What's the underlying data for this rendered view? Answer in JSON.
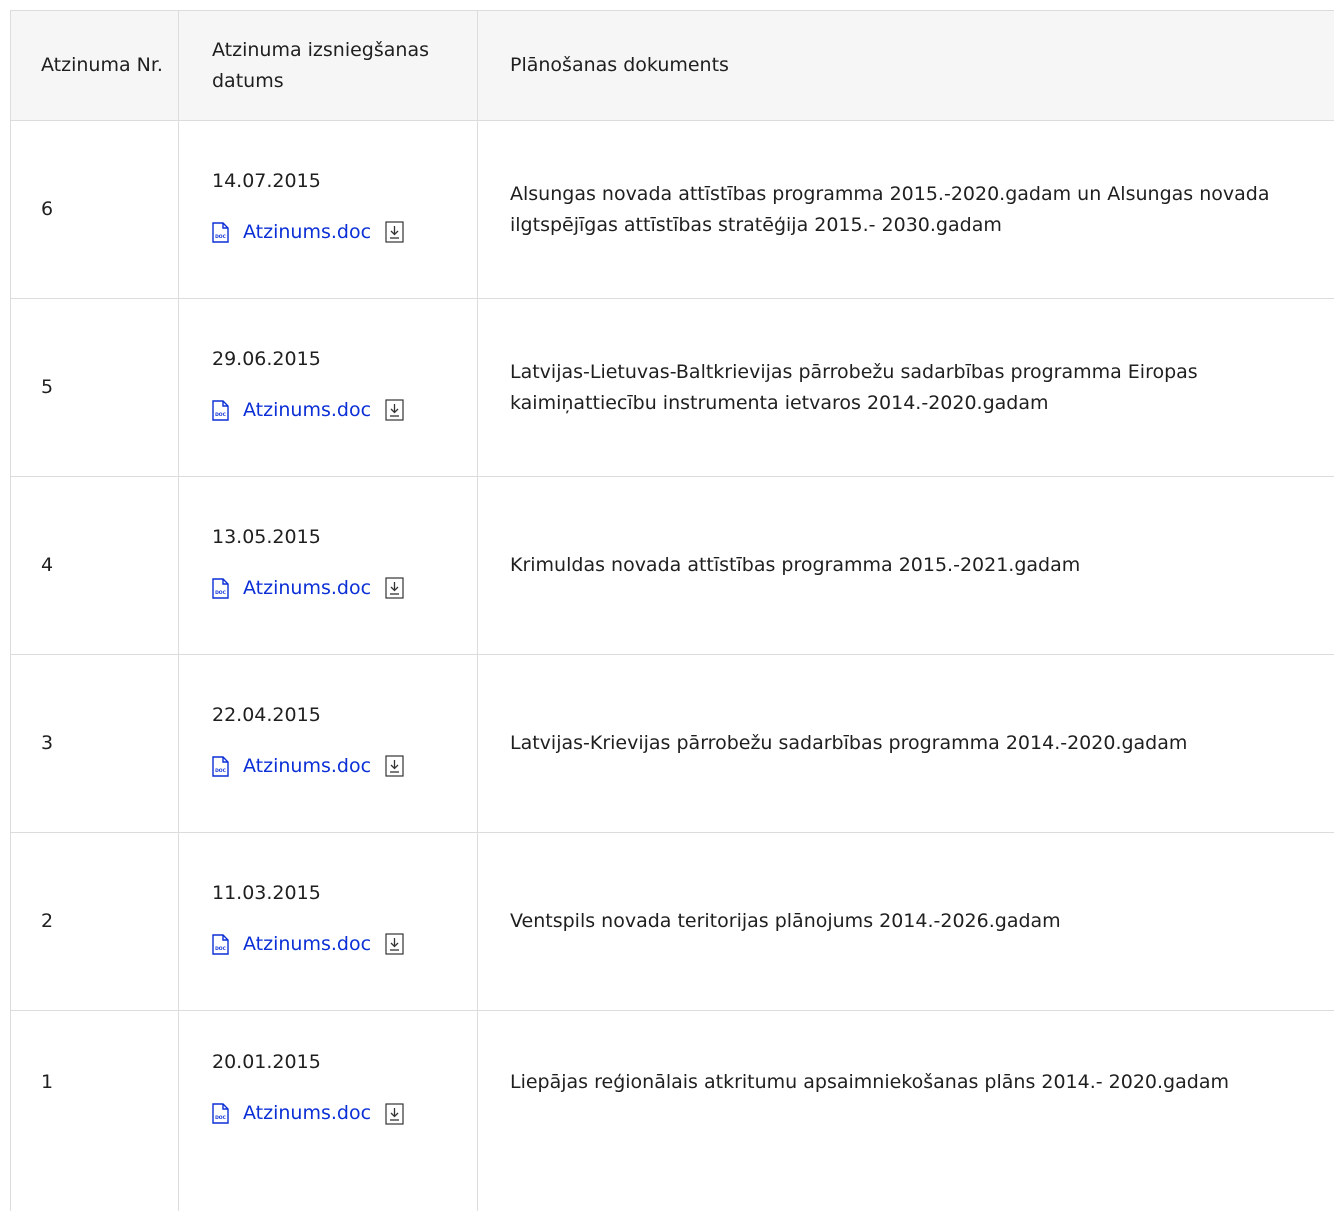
{
  "table": {
    "headers": {
      "number": "Atzinuma Nr.",
      "date": "Atzinuma izsniegšanas datums",
      "document": "Plānošanas dokuments"
    },
    "rows": [
      {
        "number": "6",
        "date": "14.07.2015",
        "file_label": "Atzinums.doc",
        "document": "Alsungas novada attīstības programma 2015.-2020.gadam un Alsungas novada ilgtspējīgas attīstības stratēģija 2015.- 2030.gadam"
      },
      {
        "number": "5",
        "date": "29.06.2015",
        "file_label": "Atzinums.doc",
        "document": "Latvijas-Lietuvas-Baltkrievijas pārrobežu sadarbības programma Eiropas kaimiņattiecību instrumenta ietvaros 2014.-2020.gadam"
      },
      {
        "number": "4",
        "date": "13.05.2015",
        "file_label": "Atzinums.doc",
        "document": "Krimuldas novada attīstības programma 2015.-2021.gadam"
      },
      {
        "number": "3",
        "date": "22.04.2015",
        "file_label": "Atzinums.doc",
        "document": "Latvijas-Krievijas pārrobežu sadarbības programma 2014.-2020.gadam"
      },
      {
        "number": "2",
        "date": "11.03.2015",
        "file_label": "Atzinums.doc",
        "document": "Ventspils novada teritorijas plānojums 2014.-2026.gadam"
      },
      {
        "number": "1",
        "date": "20.01.2015",
        "file_label": "Atzinums.doc",
        "document": "Liepājas reģionālais atkritumu apsaimniekošanas plāns 2014.- 2020.gadam"
      }
    ]
  },
  "icons": {
    "file": "doc-file-icon",
    "download": "download-icon"
  },
  "colors": {
    "link": "#0b2fd6",
    "border": "#dcdcdc",
    "header_bg": "#f6f6f6"
  }
}
